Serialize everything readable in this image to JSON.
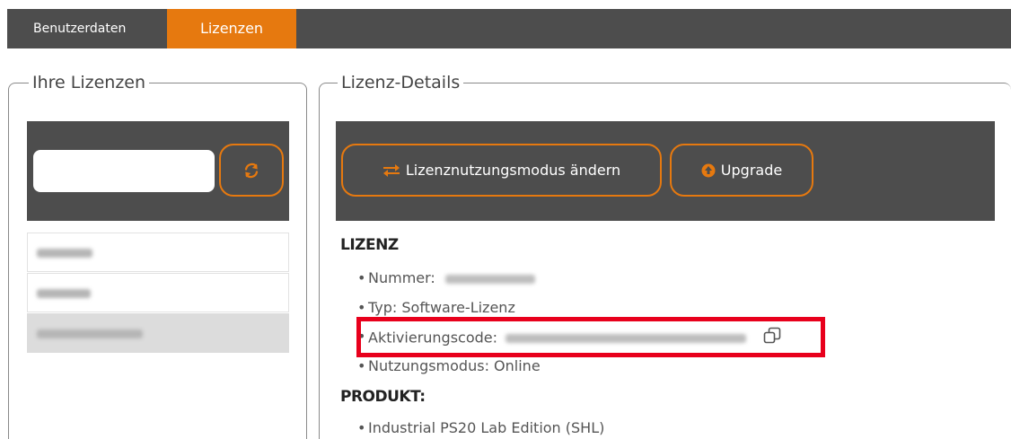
{
  "tabs": [
    {
      "label": "Benutzerdaten",
      "active": false
    },
    {
      "label": "Lizenzen",
      "active": true
    }
  ],
  "left": {
    "legend": "Ihre Lizenzen",
    "search": {
      "value": "",
      "placeholder": ""
    },
    "refresh_icon": "refresh-icon",
    "items": [
      {
        "selected": false
      },
      {
        "selected": false
      },
      {
        "selected": true
      }
    ]
  },
  "right": {
    "legend": "Lizenz-Details",
    "buttons": {
      "mode_label": "Lizenznutzungsmodus ändern",
      "upgrade_label": "Upgrade"
    },
    "license": {
      "heading": "LIZENZ",
      "number_label": "Nummer:",
      "type_label": "Typ:",
      "type_value": "Software-Lizenz",
      "activation_label": "Aktivierungscode:",
      "usage_label": "Nutzungsmodus:",
      "usage_value": "Online"
    },
    "product": {
      "heading": "PRODUKT:",
      "items": [
        "Industrial PS20 Lab Edition (SHL)"
      ]
    }
  },
  "colors": {
    "accent": "#e6790f",
    "bar": "#4d4d4d",
    "highlight": "#e8001c"
  }
}
